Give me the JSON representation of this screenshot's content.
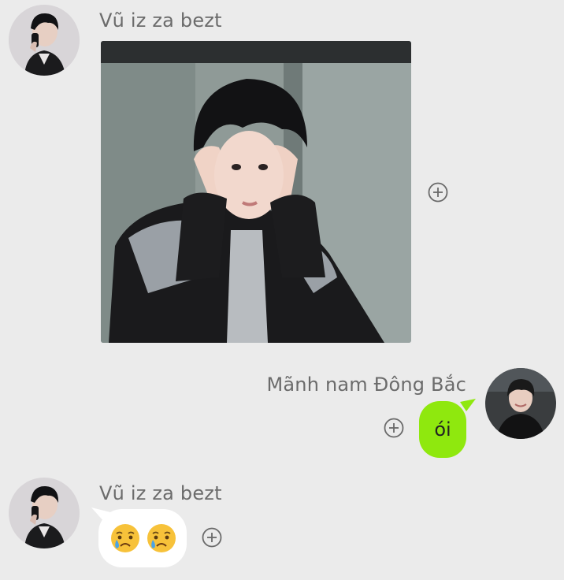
{
  "messages": [
    {
      "sender": "Vũ iz za bezt",
      "type": "image",
      "side": "left"
    },
    {
      "sender": "Mãnh nam Đông Bắc",
      "type": "text",
      "text": "ói",
      "side": "right"
    },
    {
      "sender": "Vũ iz za bezt",
      "type": "emoji",
      "emojis": [
        "crying-face",
        "crying-face"
      ],
      "side": "left"
    }
  ],
  "colors": {
    "background": "#ebebeb",
    "own_bubble": "#8fe80e",
    "other_bubble": "#ffffff",
    "sender_name": "#6b6b6b"
  },
  "icons": {
    "reaction": "add-reaction-icon",
    "emoji": "crying-face-emoji"
  }
}
